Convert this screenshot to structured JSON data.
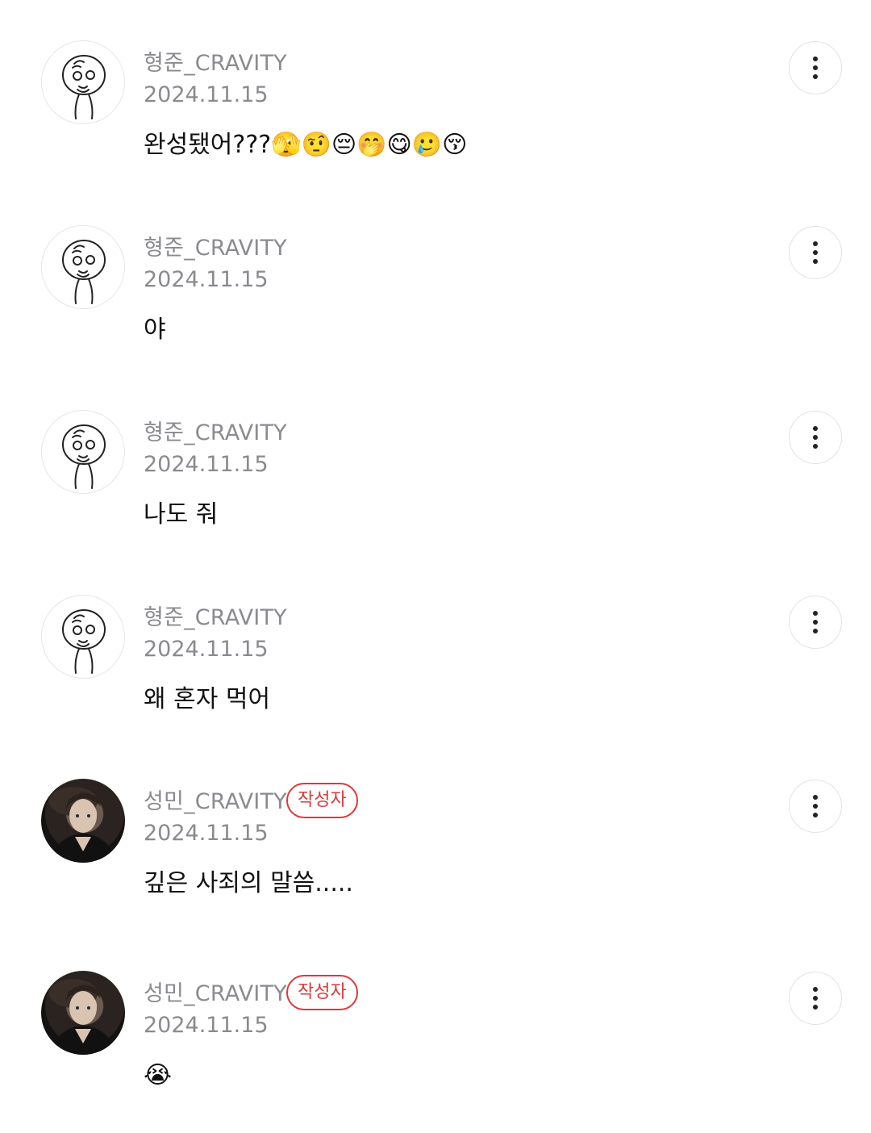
{
  "comments": [
    {
      "username": "형준_CRAVITY",
      "date": "2024.11.15",
      "text": "완성됐어???🫣🤨😔🤭😋🥲😚",
      "avatar": "sketch-avatar",
      "is_author": false
    },
    {
      "username": "형준_CRAVITY",
      "date": "2024.11.15",
      "text": "야",
      "avatar": "sketch-avatar",
      "is_author": false
    },
    {
      "username": "형준_CRAVITY",
      "date": "2024.11.15",
      "text": "나도 줘",
      "avatar": "sketch-avatar",
      "is_author": false
    },
    {
      "username": "형준_CRAVITY",
      "date": "2024.11.15",
      "text": "왜 혼자 먹어",
      "avatar": "sketch-avatar",
      "is_author": false
    },
    {
      "username": "성민_CRAVITY",
      "badge": "작성자",
      "date": "2024.11.15",
      "text": "깊은 사죄의 말씀.....",
      "avatar": "photo-avatar",
      "is_author": true
    },
    {
      "username": "성민_CRAVITY",
      "badge": "작성자",
      "date": "2024.11.15",
      "text": "😭",
      "avatar": "photo-avatar",
      "is_author": true
    }
  ],
  "icons": {
    "more": "more-vertical-icon"
  },
  "colors": {
    "meta_text": "#8a8a8f",
    "body_text": "#111111",
    "author_badge": "#d93a3a",
    "divider": "#e3e3e6"
  }
}
